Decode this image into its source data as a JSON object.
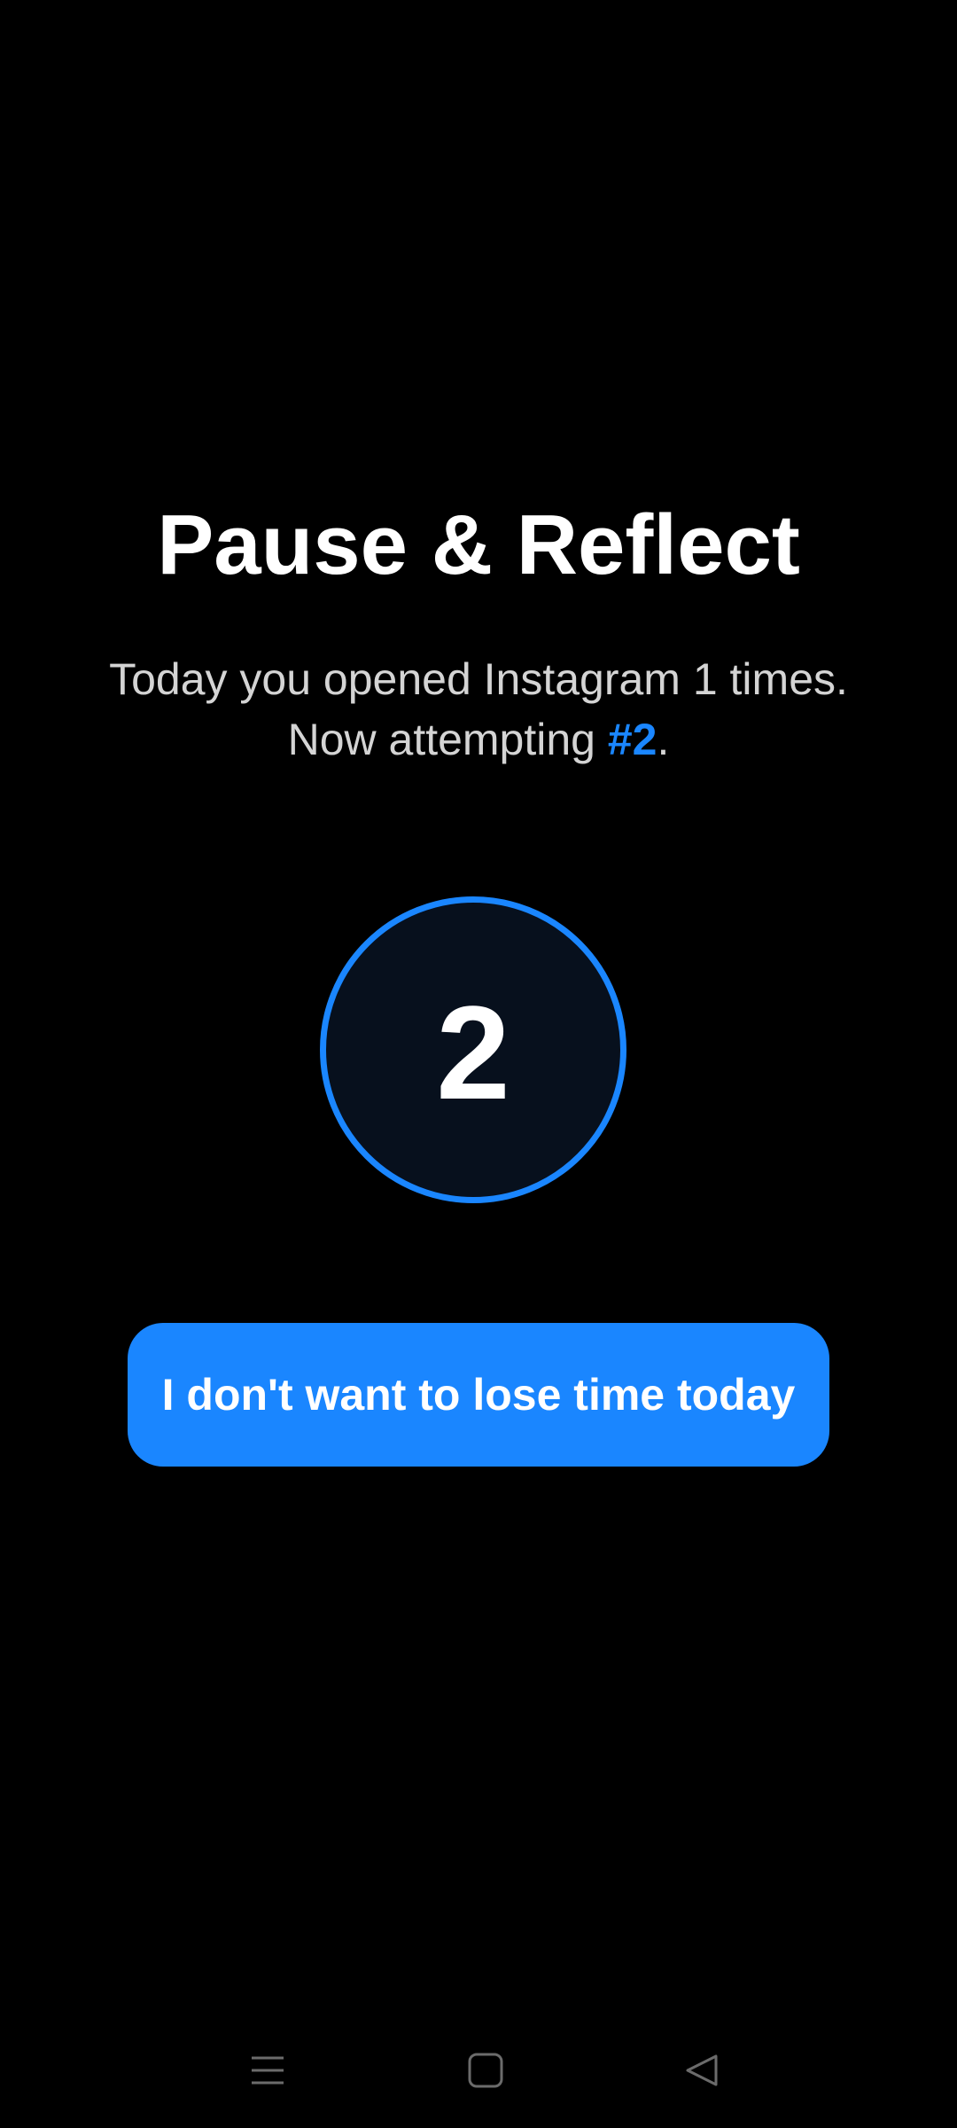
{
  "screen": {
    "title": "Pause & Reflect",
    "subtitle_line1": "Today you opened Instagram 1 times.",
    "subtitle_line2_prefix": "Now attempting ",
    "attempt_label": "#2",
    "subtitle_line2_suffix": ".",
    "counter_value": "2",
    "cta_label": "I don't want to lose time today"
  },
  "navbar": {
    "icons": [
      "menu-icon",
      "home-square-icon",
      "back-triangle-icon"
    ]
  },
  "colors": {
    "background": "#000000",
    "accent": "#1a86ff",
    "ring_fill": "#07101d",
    "subtitle_text": "#d4d4d4",
    "nav_icon": "#6b6b6b"
  }
}
